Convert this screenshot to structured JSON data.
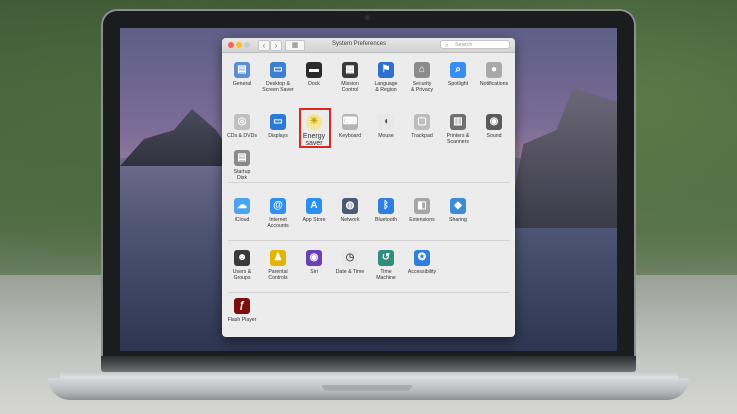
{
  "window": {
    "title": "System Preferences",
    "search_placeholder": "Search",
    "nav_back": "‹",
    "nav_forward": "›",
    "grid_glyph": "▦"
  },
  "rows": [
    {
      "items": [
        {
          "label": "General",
          "icon": "general-icon",
          "color": "#5a8fd6"
        },
        {
          "label": "Desktop &\nScreen Saver",
          "icon": "desktop-screensaver-icon",
          "color": "#3b7fd1"
        },
        {
          "label": "Dock",
          "icon": "dock-icon",
          "color": "#2b2b2b"
        },
        {
          "label": "Mission\nControl",
          "icon": "mission-control-icon",
          "color": "#3a3a3a"
        },
        {
          "label": "Language\n& Region",
          "icon": "language-region-icon",
          "color": "#2f6fd0"
        },
        {
          "label": "Security\n& Privacy",
          "icon": "security-privacy-icon",
          "color": "#8b8b8b"
        },
        {
          "label": "Spotlight",
          "icon": "spotlight-icon",
          "color": "#3a8df0"
        },
        {
          "label": "Notifications",
          "icon": "notifications-icon",
          "color": "#a9a9a9"
        }
      ]
    },
    {
      "items": [
        {
          "label": "CDs & DVDs",
          "icon": "cds-dvds-icon",
          "color": "#c0c0c0"
        },
        {
          "label": "Displays",
          "icon": "displays-icon",
          "color": "#2b7ad6"
        },
        {
          "label": "Energy\nsaver",
          "icon": "energy-saver-icon",
          "color": "#f4e79a"
        },
        {
          "label": "Keyboard",
          "icon": "keyboard-icon",
          "color": "#b5b5b5"
        },
        {
          "label": "Mouse",
          "icon": "mouse-icon",
          "color": "#e8e8e8"
        },
        {
          "label": "Trackpad",
          "icon": "trackpad-icon",
          "color": "#bdbdbd"
        },
        {
          "label": "Printers &\nScanners",
          "icon": "printers-scanners-icon",
          "color": "#6f6f6f"
        },
        {
          "label": "Sound",
          "icon": "sound-icon",
          "color": "#5a5a5a"
        },
        {
          "label": "Startup\nDisk",
          "icon": "startup-disk-icon",
          "color": "#8a8a8a"
        }
      ]
    },
    {
      "items": [
        {
          "label": "iCloud",
          "icon": "icloud-icon",
          "color": "#4da3f0"
        },
        {
          "label": "Internet\nAccounts",
          "icon": "internet-accounts-icon",
          "color": "#2f8ff0"
        },
        {
          "label": "App Store",
          "icon": "app-store-icon",
          "color": "#2b8ef2"
        },
        {
          "label": "Network",
          "icon": "network-icon",
          "color": "#4b5a78"
        },
        {
          "label": "Bluetooth",
          "icon": "bluetooth-icon",
          "color": "#2f7fe0"
        },
        {
          "label": "Extensions",
          "icon": "extensions-icon",
          "color": "#a6a6a6"
        },
        {
          "label": "Sharing",
          "icon": "sharing-icon",
          "color": "#3a8bd8"
        }
      ]
    },
    {
      "items": [
        {
          "label": "Users &\nGroups",
          "icon": "users-groups-icon",
          "color": "#3a3a3a"
        },
        {
          "label": "Parental\nControls",
          "icon": "parental-controls-icon",
          "color": "#e6b400"
        },
        {
          "label": "Siri",
          "icon": "siri-icon",
          "color": "#6b3fb5"
        },
        {
          "label": "Date & Time",
          "icon": "date-time-icon",
          "color": "#e8e8e8"
        },
        {
          "label": "Time\nMachine",
          "icon": "time-machine-icon",
          "color": "#2f8f7a"
        },
        {
          "label": "Accessibility",
          "icon": "accessibility-icon",
          "color": "#2f7fe0"
        }
      ]
    },
    {
      "items": [
        {
          "label": "Flash Player",
          "icon": "flash-player-icon",
          "color": "#7a0d0d"
        }
      ]
    }
  ]
}
